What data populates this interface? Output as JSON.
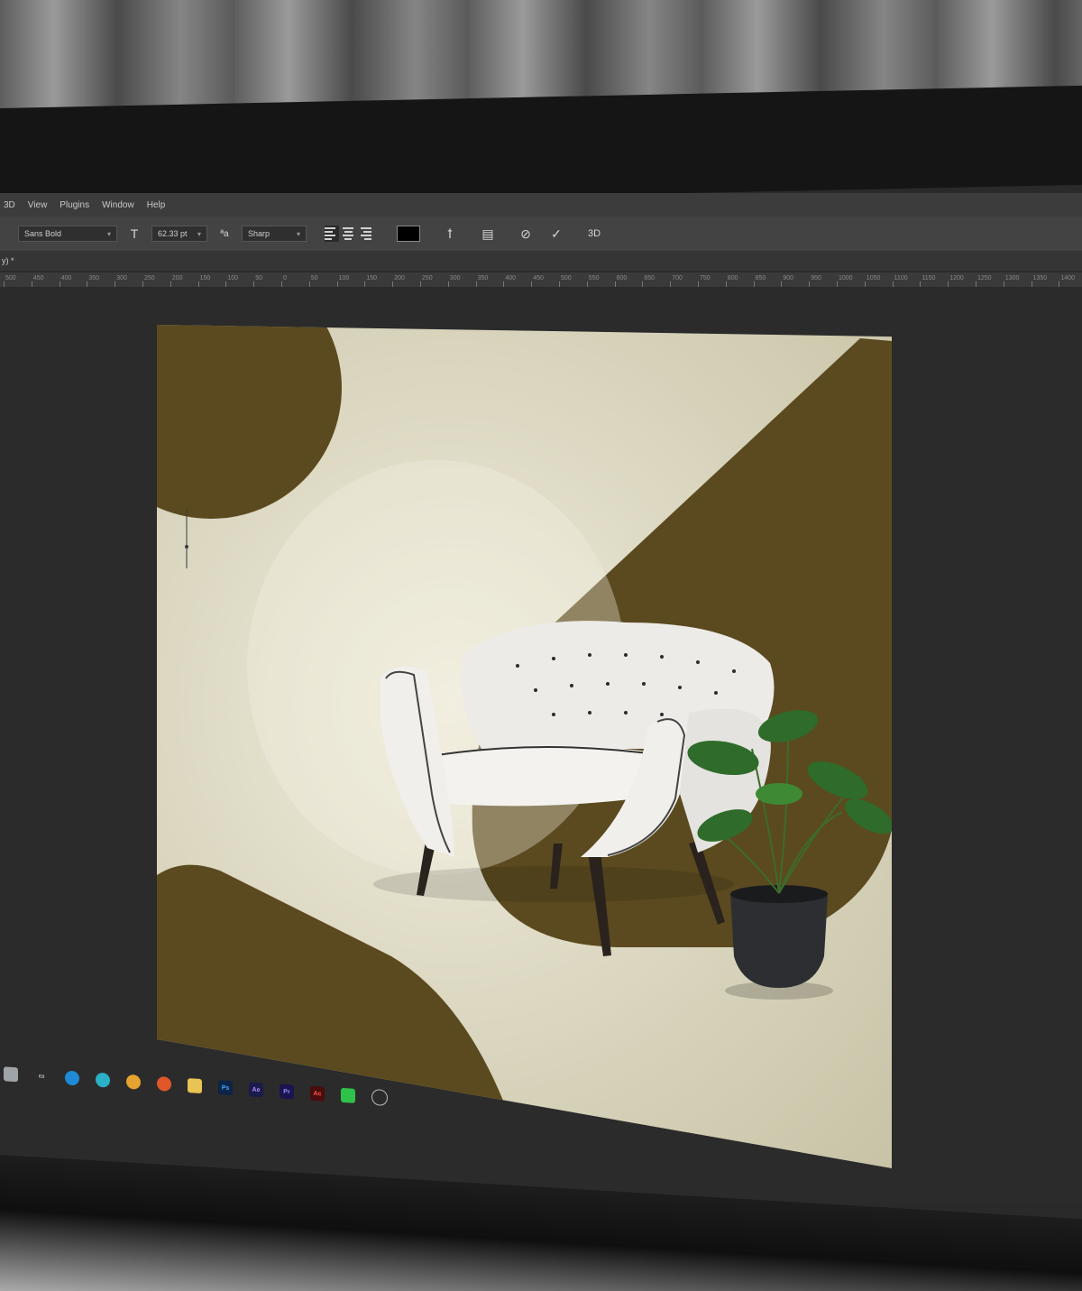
{
  "menu": {
    "items": [
      "3D",
      "View",
      "Plugins",
      "Window",
      "Help"
    ]
  },
  "options": {
    "font_family": "Sans Bold",
    "font_size": "62.33 pt",
    "antialias": "Sharp",
    "color_swatch": "#000000"
  },
  "tab": {
    "label": "y) *"
  },
  "ruler": {
    "labels": [
      "500",
      "450",
      "400",
      "350",
      "300",
      "250",
      "200",
      "150",
      "100",
      "50",
      "0",
      "50",
      "100",
      "150",
      "200",
      "250",
      "300",
      "350",
      "400",
      "450",
      "500",
      "550",
      "600",
      "650",
      "700",
      "750",
      "800",
      "850",
      "900",
      "950",
      "1000",
      "1050",
      "1100",
      "1150",
      "1200",
      "1250",
      "1300",
      "1350",
      "1400"
    ]
  },
  "colors": {
    "olive": "#5b4a1f",
    "cream": "#dcd8c2",
    "workspace": "#2b2b2b",
    "panel": "#434343"
  },
  "taskbar": {
    "icons": [
      "explorer-icon",
      "edge-icon",
      "edge-dev-icon",
      "chrome-icon",
      "firefox-icon",
      "folder-icon",
      "photoshop-icon",
      "after-effects-icon",
      "premiere-icon",
      "acrobat-icon",
      "green-app-icon",
      "circle-app-icon"
    ],
    "labels": [
      "Ps",
      "Ae",
      "Pr",
      "Ac"
    ]
  }
}
